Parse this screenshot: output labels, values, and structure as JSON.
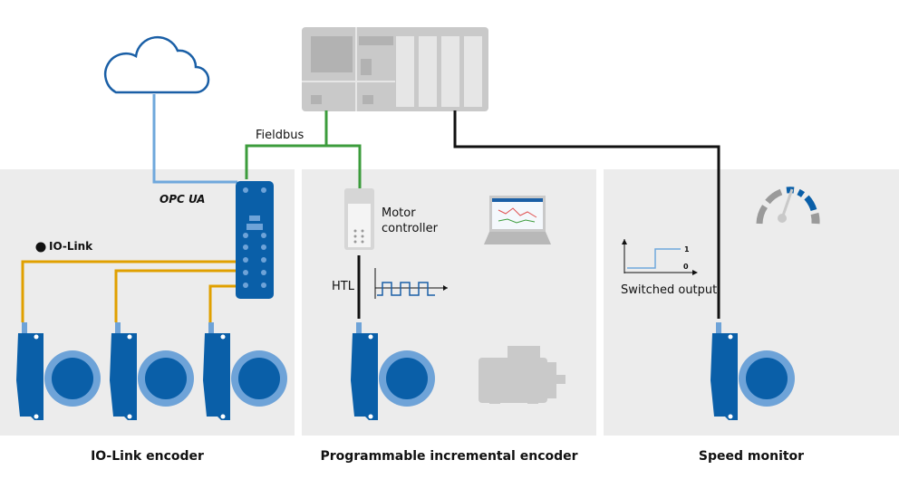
{
  "labels": {
    "fieldbus": "Fieldbus",
    "opc_ua": "OPC UA",
    "io_link": "IO-Link",
    "motor_controller_line1": "Motor",
    "motor_controller_line2": "controller",
    "htl": "HTL",
    "switched_output": "Switched output",
    "signal_high": "1",
    "signal_low": "0"
  },
  "sections": [
    {
      "caption": "IO-Link encoder"
    },
    {
      "caption": "Programmable incremental encoder"
    },
    {
      "caption": "Speed monitor"
    }
  ],
  "colors": {
    "panel": "#ececec",
    "encoder_blue": "#0a5fa8",
    "encoder_ring": "#6ea3d8",
    "fieldbus_green": "#3c9c3c",
    "io_link_yellow": "#e0a000",
    "cloud_blue": "#6fa8dc",
    "plc_gray": "#c9c9c9"
  }
}
